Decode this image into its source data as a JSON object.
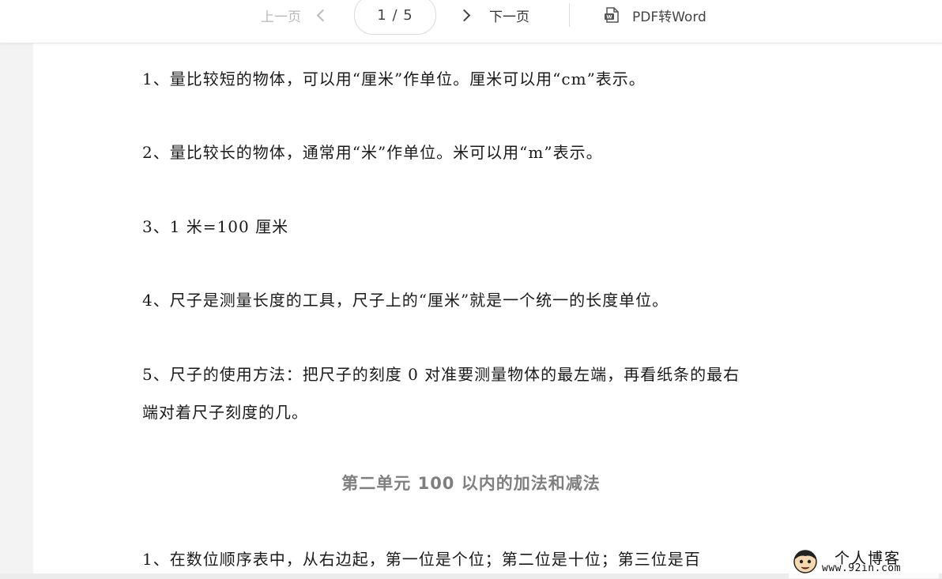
{
  "toolbar": {
    "prev_label": "上一页",
    "page_indicator": "1 / 5",
    "next_label": "下一页",
    "pdf_to_word_label": "PDF转Word"
  },
  "document": {
    "paragraphs": [
      "1、量比较短的物体，可以用“厘米”作单位。厘米可以用“cm”表示。",
      "2、量比较长的物体，通常用“米”作单位。米可以用“m”表示。",
      "3、1 米=100 厘米",
      "4、尺子是测量长度的工具，尺子上的“厘米”就是一个统一的长度单位。",
      "5、尺子的使用方法：把尺子的刻度 0 对准要测量物体的最左端，再看纸条的最右",
      "端对着尺子刻度的几。"
    ],
    "section_heading": "第二单元 100 以内的加法和减法",
    "last_paragraph": "1、在数位顺序表中，从右边起，第一位是个位；第二位是十位；第三位是百"
  },
  "watermark": {
    "title": "个人博客",
    "url": "www.92in.com"
  }
}
